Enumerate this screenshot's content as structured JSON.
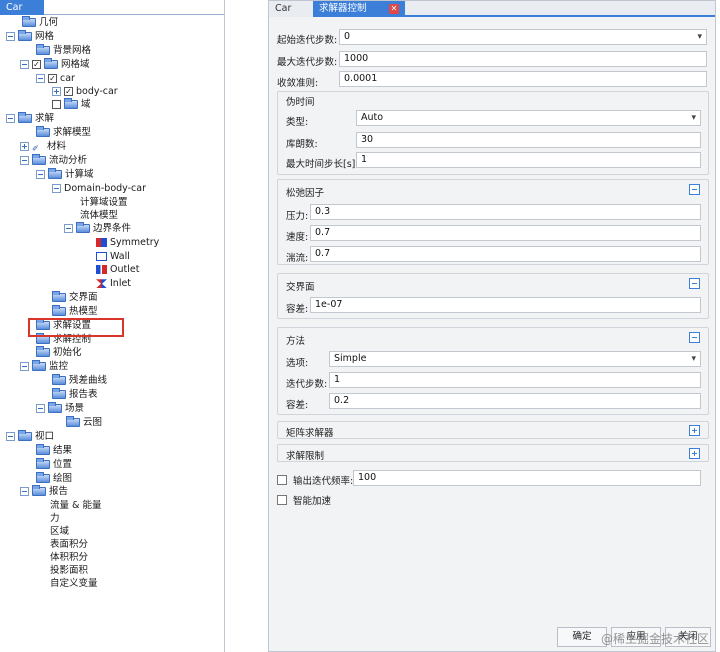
{
  "left_panel": {
    "tab": "Car",
    "tree": [
      {
        "label": "几何"
      },
      {
        "label": "网格"
      },
      {
        "label": "背景网格"
      },
      {
        "label": "网格域"
      },
      {
        "label": "car"
      },
      {
        "label": "body-car"
      },
      {
        "label": "域"
      },
      {
        "label": "求解"
      },
      {
        "label": "求解模型"
      },
      {
        "label": "材料"
      },
      {
        "label": "流动分析"
      },
      {
        "label": "计算域"
      },
      {
        "label": "Domain-body-car"
      },
      {
        "label": "计算域设置"
      },
      {
        "label": "流体模型"
      },
      {
        "label": "边界条件"
      },
      {
        "label": "Symmetry"
      },
      {
        "label": "Wall"
      },
      {
        "label": "Outlet"
      },
      {
        "label": "Inlet"
      },
      {
        "label": "交界面"
      },
      {
        "label": "热模型"
      },
      {
        "label": "求解设置"
      },
      {
        "label": "求解控制"
      },
      {
        "label": "初始化"
      },
      {
        "label": "监控"
      },
      {
        "label": "残差曲线"
      },
      {
        "label": "报告表"
      },
      {
        "label": "场景"
      },
      {
        "label": "云图"
      },
      {
        "label": "视口"
      },
      {
        "label": "结果"
      },
      {
        "label": "位置"
      },
      {
        "label": "绘图"
      },
      {
        "label": "报告"
      },
      {
        "label": "流量 & 能量"
      },
      {
        "label": "力"
      },
      {
        "label": "区域"
      },
      {
        "label": "表面积分"
      },
      {
        "label": "体积积分"
      },
      {
        "label": "投影面积"
      },
      {
        "label": "自定义变量"
      }
    ]
  },
  "right_panel": {
    "tabs": {
      "inactive": "Car",
      "active": "求解器控制"
    },
    "top_fields": {
      "start_iter_label": "起始迭代步数:",
      "start_iter_value": "0",
      "max_iter_label": "最大迭代步数:",
      "max_iter_value": "1000",
      "conv_label": "收敛准则:",
      "conv_value": "0.0001"
    },
    "pseudo_time": {
      "title": "伪时间",
      "type_label": "类型:",
      "type_value": "Auto",
      "courant_label": "库朗数:",
      "courant_value": "30",
      "max_step_label": "最大时间步长[s]:",
      "max_step_value": "1"
    },
    "relaxation": {
      "title": "松弛因子",
      "pressure_label": "压力:",
      "pressure_value": "0.3",
      "velocity_label": "速度:",
      "velocity_value": "0.7",
      "turb_label": "湍流:",
      "turb_value": "0.7"
    },
    "interface": {
      "title": "交界面",
      "tol_label": "容差:",
      "tol_value": "1e-07"
    },
    "method": {
      "title": "方法",
      "option_label": "选项:",
      "option_value": "Simple",
      "iter_label": "迭代步数:",
      "iter_value": "1",
      "tol_label": "容差:",
      "tol_value": "0.2"
    },
    "matrix_solver": {
      "title": "矩阵求解器"
    },
    "solve_limits": {
      "title": "求解限制"
    },
    "output_freq": {
      "label": "输出迭代频率:",
      "value": "100"
    },
    "smart_accel": {
      "label": "智能加速"
    },
    "buttons": {
      "ok": "确定",
      "apply": "应用",
      "close": "关闭"
    },
    "watermark": "@稀土掘金技术社区"
  }
}
